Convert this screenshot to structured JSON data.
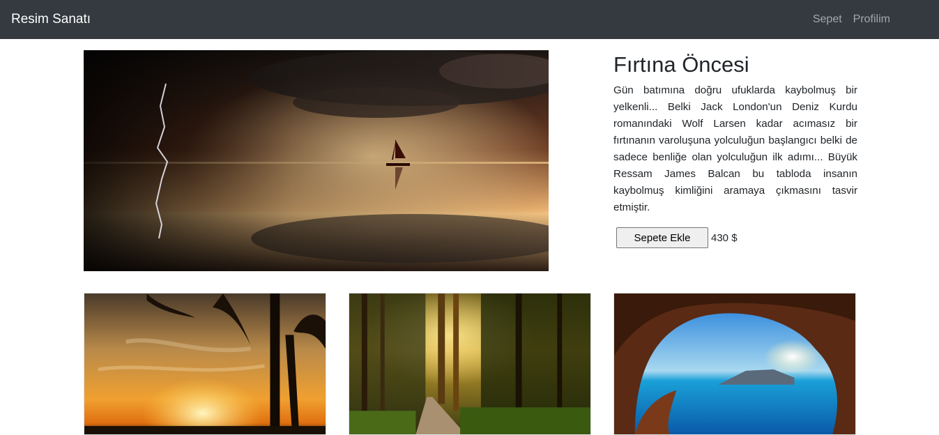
{
  "navbar": {
    "brand": "Resim Sanatı",
    "links": [
      "Sepet",
      "Profilim"
    ]
  },
  "featured": {
    "title": "Fırtına Öncesi",
    "description": "Gün batımına doğru ufuklarda kaybolmuş bir yelkenli... Belki Jack London'un Deniz Kurdu romanındaki Wolf Larsen kadar acımasız bir fırtınanın varoluşuna yolculuğun başlangıcı belki de sadece benliğe olan yolculuğun ilk adımı... Büyük Ressam James Balcan bu tabloda insanın kaybolmuş kimliğini aramaya çıkmasını tasvir etmiştir.",
    "add_to_cart_label": "Sepete Ekle",
    "price": "430 $"
  },
  "colors": {
    "navbar_bg": "#343a40",
    "brand_text": "#ffffff",
    "nav_link_text": "rgba(255,255,255,0.55)"
  }
}
